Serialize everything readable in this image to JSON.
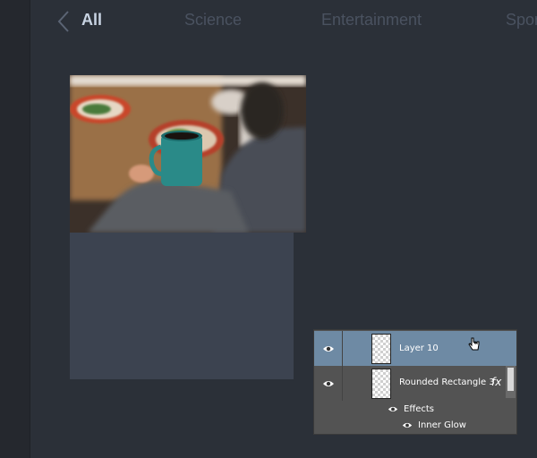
{
  "nav": {
    "back_label": "All",
    "categories": [
      "Science",
      "Entertainment",
      "Spor"
    ]
  },
  "layers": {
    "rows": [
      {
        "name": "Layer 10",
        "selected": true
      },
      {
        "name": "Rounded Rectangle 3",
        "fx": "fx",
        "selected": false
      }
    ],
    "effects_label": "Effects",
    "effect_items": [
      "Inner Glow"
    ]
  }
}
